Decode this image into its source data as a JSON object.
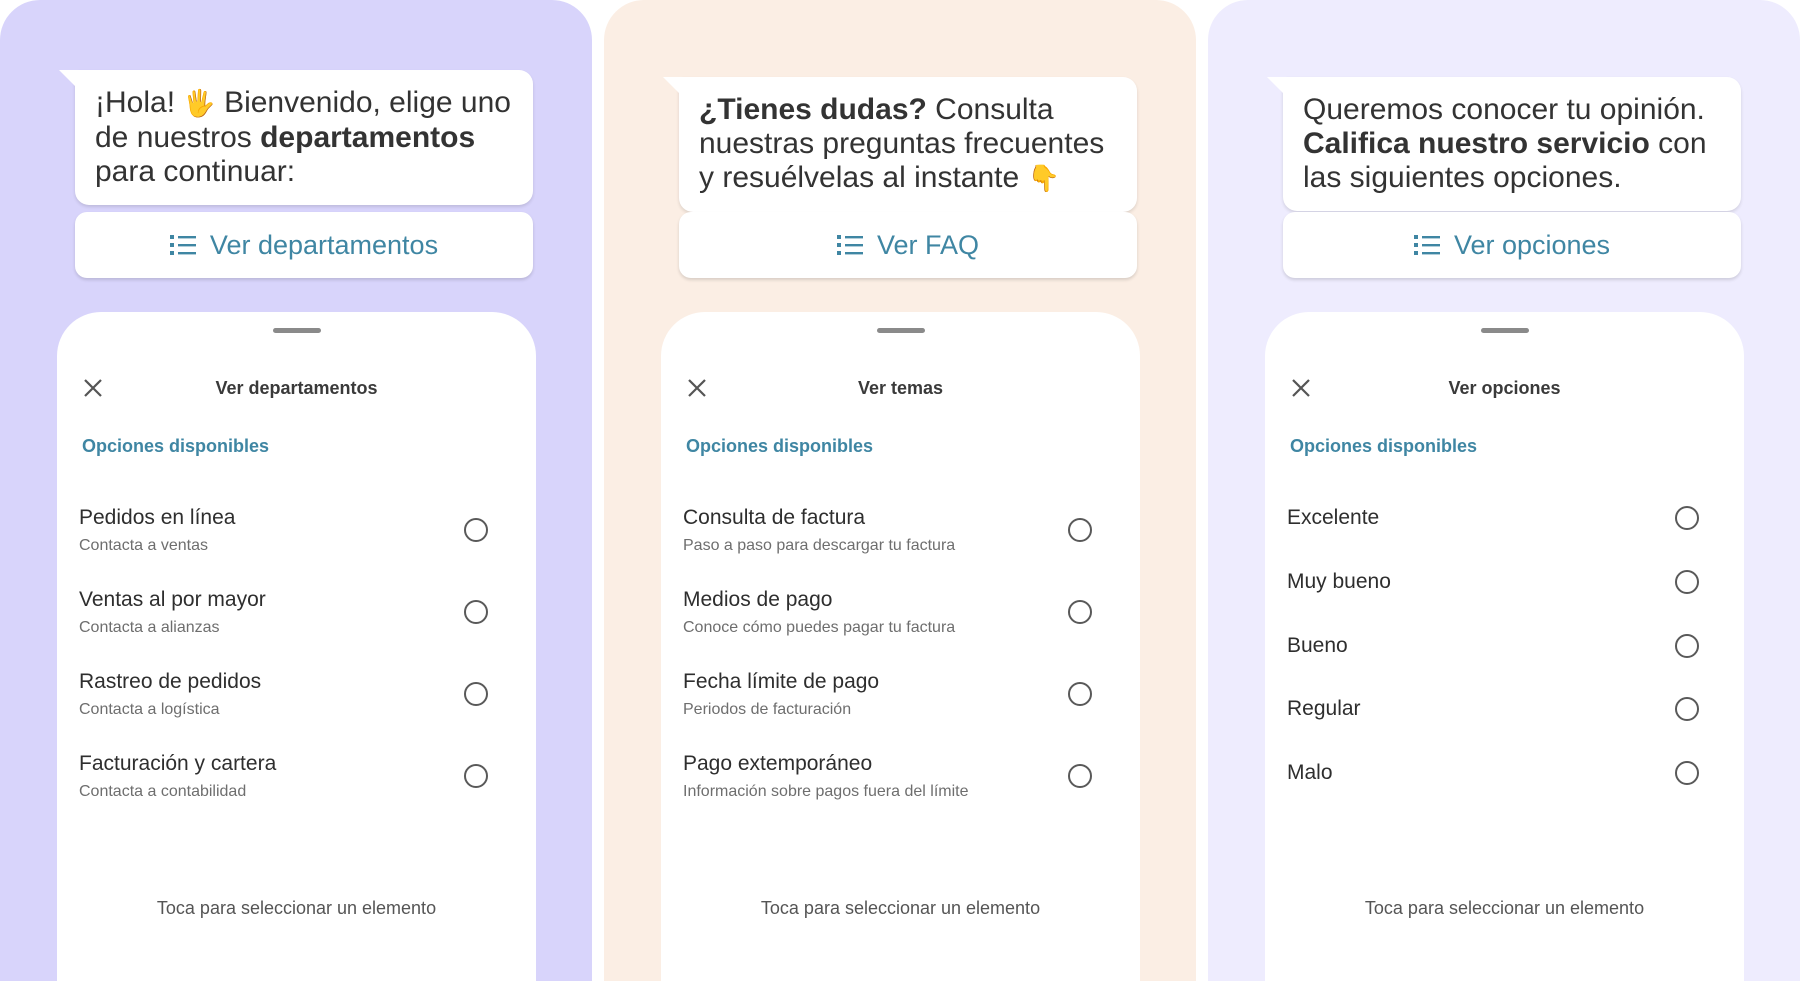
{
  "colors": {
    "panel1_bg": "#d8d4fb",
    "panel2_bg": "#fbeee4",
    "panel3_bg": "#eeecfe",
    "accent": "#3f86a3"
  },
  "panels": [
    {
      "bubble": {
        "pre": "¡Hola! ",
        "emoji": "🖐",
        "mid": " Bienvenido, elige uno de nuestros ",
        "bold": "departamentos",
        "post": " para continuar:"
      },
      "button_label": "Ver departamentos",
      "sheet": {
        "title": "Ver departamentos",
        "section": "Opciones disponibles",
        "items": [
          {
            "title": "Pedidos en línea",
            "subtitle": "Contacta a ventas"
          },
          {
            "title": "Ventas al por mayor",
            "subtitle": "Contacta a alianzas"
          },
          {
            "title": "Rastreo de pedidos",
            "subtitle": "Contacta a logística"
          },
          {
            "title": "Facturación y cartera",
            "subtitle": "Contacta a contabilidad"
          }
        ],
        "footer": "Toca para seleccionar un elemento"
      }
    },
    {
      "bubble": {
        "bold": "¿Tienes dudas?",
        "post": " Consulta nuestras preguntas frecuentes y resuélvelas al instante ",
        "emoji": "👇"
      },
      "button_label": "Ver FAQ",
      "sheet": {
        "title": "Ver temas",
        "section": "Opciones disponibles",
        "items": [
          {
            "title": "Consulta de factura",
            "subtitle": "Paso a paso para descargar tu factura"
          },
          {
            "title": "Medios de pago",
            "subtitle": "Conoce cómo puedes pagar tu factura"
          },
          {
            "title": "Fecha límite de pago",
            "subtitle": "Periodos de facturación"
          },
          {
            "title": "Pago extemporáneo",
            "subtitle": "Información sobre pagos fuera del límite"
          }
        ],
        "footer": "Toca para seleccionar un elemento"
      }
    },
    {
      "bubble": {
        "pre": "Queremos conocer tu opinión. ",
        "bold": "Califica nuestro servicio",
        "post": " con las siguientes opciones."
      },
      "button_label": "Ver opciones",
      "sheet": {
        "title": "Ver opciones",
        "section": "Opciones disponibles",
        "items": [
          {
            "title": "Excelente"
          },
          {
            "title": "Muy bueno"
          },
          {
            "title": "Bueno"
          },
          {
            "title": "Regular"
          },
          {
            "title": "Malo"
          }
        ],
        "footer": "Toca para seleccionar un elemento"
      }
    }
  ]
}
